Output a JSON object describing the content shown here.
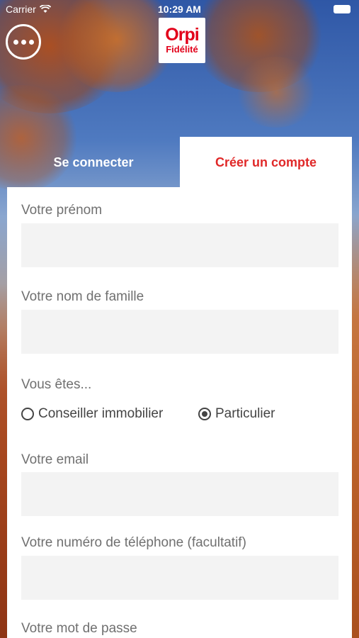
{
  "status_bar": {
    "carrier": "Carrier",
    "time": "10:29 AM"
  },
  "header": {
    "menu_icon": "more-dots-icon",
    "logo": {
      "brand": "Orpi",
      "subtitle": "Fidélité"
    }
  },
  "tabs": [
    {
      "label": "Se connecter",
      "active": false
    },
    {
      "label": "Créer un compte",
      "active": true
    }
  ],
  "form": {
    "first_name": {
      "label": "Votre prénom",
      "value": ""
    },
    "last_name": {
      "label": "Votre nom de famille",
      "value": ""
    },
    "role": {
      "label": "Vous êtes...",
      "options": [
        {
          "label": "Conseiller immobilier",
          "selected": false
        },
        {
          "label": "Particulier",
          "selected": true
        }
      ]
    },
    "email": {
      "label": "Votre email",
      "value": ""
    },
    "phone": {
      "label": "Votre numéro de téléphone (facultatif)",
      "value": ""
    },
    "password": {
      "label": "Votre mot de passe"
    }
  },
  "colors": {
    "brand_red": "#e2001a",
    "active_tab_text": "#e02828",
    "field_background": "#f3f3f3",
    "label_text": "#707070"
  }
}
